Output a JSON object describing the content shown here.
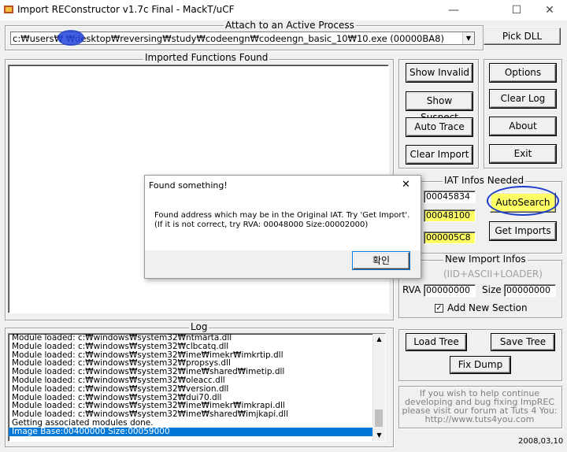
{
  "window": {
    "title": "Import REConstructor v1.7c Final - MackT/uCF",
    "minimize": "—",
    "maximize": "☐",
    "close": "✕"
  },
  "attach": {
    "label": "Attach to an Active Process",
    "process_path": "c:₩users₩      ₩desktop₩reversing₩study₩codeengn₩codeengn_basic_10₩10.exe (00000BA8)",
    "pick_dll": "Pick DLL"
  },
  "imported_functions": {
    "label": "Imported Functions Found"
  },
  "buttons": {
    "show_invalid": "Show Invalid",
    "show_suspect": "Show Suspect",
    "auto_trace": "Auto Trace",
    "clear_import": "Clear Import",
    "options": "Options",
    "clear_log": "Clear Log",
    "about": "About",
    "exit": "Exit"
  },
  "iat": {
    "label": "IAT Infos Needed",
    "oep": "00045834",
    "rva": "00048100",
    "size": "000005C8",
    "autosearch": "AutoSearch",
    "get_imports": "Get Imports"
  },
  "new_import": {
    "label": "New Import Infos",
    "sublabel": "(IID+ASCII+LOADER)",
    "rva_label": "RVA",
    "rva_value": "00000000",
    "size_label": "Size",
    "size_value": "00000000",
    "add_section": "Add New Section",
    "add_section_checked": "✓"
  },
  "log": {
    "label": "Log",
    "lines": [
      "Module loaded: c:₩windows₩system32₩ntmarta.dll",
      "Module loaded: c:₩windows₩system32₩clbcatq.dll",
      "Module loaded: c:₩windows₩system32₩ime₩imekr₩imkrtip.dll",
      "Module loaded: c:₩windows₩system32₩propsys.dll",
      "Module loaded: c:₩windows₩system32₩ime₩shared₩imetip.dll",
      "Module loaded: c:₩windows₩system32₩oleacc.dll",
      "Module loaded: c:₩windows₩system32₩version.dll",
      "Module loaded: c:₩windows₩system32₩dui70.dll",
      "Module loaded: c:₩windows₩system32₩ime₩imekr₩imkrapi.dll",
      "Module loaded: c:₩windows₩system32₩ime₩shared₩imjkapi.dll",
      "Getting associated modules done.",
      "Image Base:00400000 Size:00059000"
    ]
  },
  "tree": {
    "load_tree": "Load Tree",
    "save_tree": "Save Tree",
    "fix_dump": "Fix Dump"
  },
  "promo": {
    "line1": "If you wish to help continue",
    "line2": "developing and bug fixing ImpREC",
    "line3": "please visit our forum at Tuts 4 You:",
    "line4": "http://www.tuts4you.com"
  },
  "date": "2008,03,10",
  "dialog": {
    "title": "Found something!",
    "close": "✕",
    "message1": "Found address which may be in the Original IAT. Try 'Get Import'.",
    "message2": "(If it is not correct, try RVA: 00048000 Size:00002000)",
    "ok": "확인"
  },
  "colors": {
    "highlight": "#ffff66",
    "annotation_blue": "#1a3cc8",
    "selection": "#0078d7"
  }
}
